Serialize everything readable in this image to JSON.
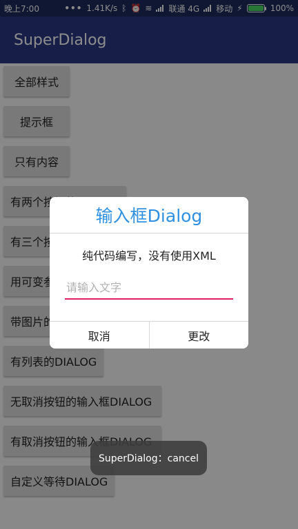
{
  "status_bar": {
    "time": "晚上7:00",
    "dots": "•••",
    "speed": "1.41K/s",
    "carrier1": "联通 4G",
    "carrier2": "移动",
    "battery": "100%",
    "bolt": "⚡",
    "icons": [
      "bluetooth-icon",
      "alarm-icon",
      "wifi-icon",
      "signal-icon",
      "signal-icon",
      "charging-icon",
      "battery-icon"
    ]
  },
  "app_bar": {
    "title": "SuperDialog"
  },
  "list": {
    "items": [
      "全部样式",
      "提示框",
      "只有内容",
      "有两个按钮的DIALOG",
      "有三个按钮的DIALOG",
      "用可变参数的DIALOG",
      "带图片的DIALOG",
      "有列表的DIALOG",
      "无取消按钮的输入框DIALOG",
      "有取消按钮的输入框DIALOG",
      "自定义等待DIALOG"
    ]
  },
  "dialog": {
    "title": "输入框Dialog",
    "message": "纯代码编写，没有使用XML",
    "input_placeholder": "请输入文字",
    "cancel": "取消",
    "confirm": "更改"
  },
  "toast": {
    "text": "SuperDialog：cancel"
  },
  "colors": {
    "status_bar": "#1d2a5c",
    "app_bar": "#2a3a86",
    "dialog_title": "#2f8fe0",
    "input_underline": "#e0205f",
    "battery": "#4cd964"
  }
}
